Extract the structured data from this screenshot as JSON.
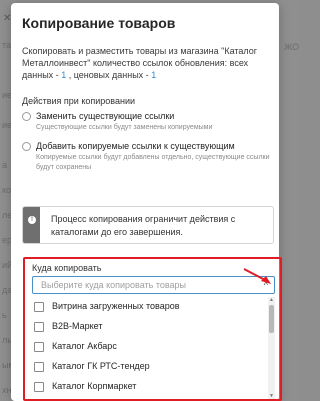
{
  "background": {
    "left_fragments": [
      "та",
      "ие",
      "ие",
      "а",
      "ко",
      "ле",
      "ер",
      "ий",
      "да",
      "ь",
      "ль",
      "ым",
      "хн"
    ],
    "right_fragment": "ЖО"
  },
  "modal": {
    "title": "Копирование товаров",
    "description_text": "Скопировать и разместить товары из магазина \"Каталог Металлоинвест\" количество ссылок обновления: всех данных -",
    "description_count_all": "1",
    "description_mid": ", ценовых данных -",
    "description_count_price": "1",
    "actions_label": "Действия при копировании",
    "options": [
      {
        "label": "Заменить существующие ссылки",
        "hint": "Существующие ссылки будут заменены копируемыми"
      },
      {
        "label": "Добавить копируемые ссылки к существующим",
        "hint": "Копируемые ссылки будут добавлены отдельно, существующие ссылки будут сохранены"
      }
    ],
    "info_icon": "!",
    "info_text": "Процесс копирования ограничит действия с каталогами до его завершения.",
    "target": {
      "label": "Куда копировать",
      "placeholder": "Выберите куда копировать товары",
      "chevron": "^",
      "items": [
        "Витрина загруженных товаров",
        "B2B-Маркет",
        "Каталог Акбарс",
        "Каталог ГК РТС-тендер",
        "Каталог Корпмаркет"
      ]
    }
  },
  "colors": {
    "accent": "#e01c24",
    "link": "#2a8bd6",
    "input_border": "#4a90c8"
  }
}
